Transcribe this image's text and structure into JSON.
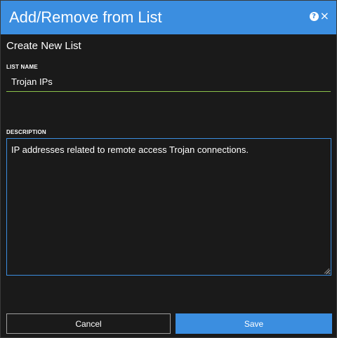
{
  "dialog": {
    "title": "Add/Remove from List",
    "help_icon": "help-icon",
    "close_icon": "close-icon"
  },
  "form": {
    "section_title": "Create New List",
    "list_name": {
      "label": "LIST NAME",
      "value": "Trojan IPs"
    },
    "description": {
      "label": "DESCRIPTION",
      "value": "IP addresses related to remote access Trojan connections."
    }
  },
  "actions": {
    "cancel_label": "Cancel",
    "save_label": "Save"
  },
  "colors": {
    "accent": "#3b8ee0",
    "background": "#1a1a1a",
    "input_underline": "#8bc34a"
  }
}
